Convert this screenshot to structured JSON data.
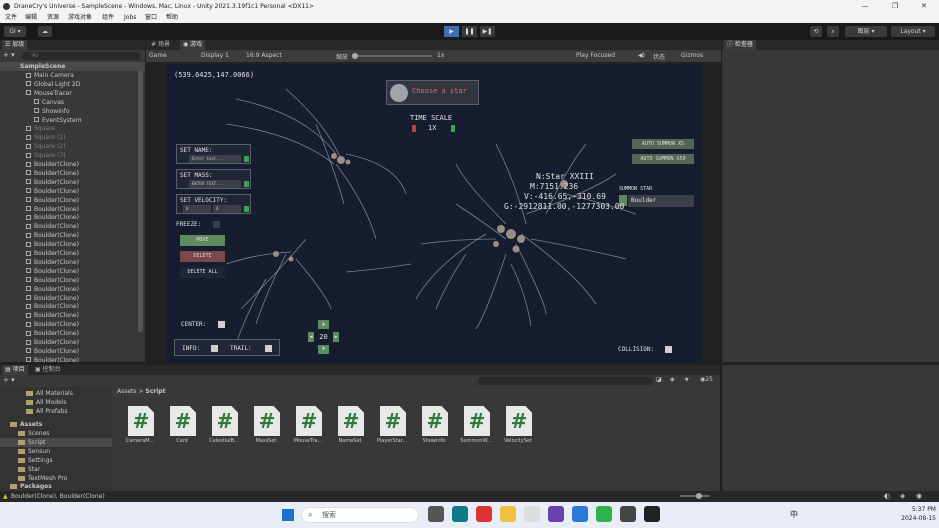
{
  "window": {
    "title": "DraneCry's Universe - SampleScene - Windows, Mac, Linux - Unity 2021.3.19f1c1 Personal <DX11>",
    "minimize": "—",
    "maximize": "❐",
    "close": "✕"
  },
  "menu": [
    "文件",
    "编辑",
    "资源",
    "游戏对象",
    "组件",
    "Jobs",
    "窗口",
    "帮助"
  ],
  "toolbar": {
    "account": "GI ▾",
    "cloud": "☁",
    "play": "▶",
    "pause": "❚❚",
    "step": "▶❚",
    "history": "⟲",
    "search": "⌕",
    "layers": "图层 ▾",
    "layout": "Layout ▾"
  },
  "hierarchy": {
    "tab": "层级",
    "add": "+ ▾",
    "search_placeholder": "All",
    "scene": "SampleScene",
    "items": [
      {
        "label": "Main Camera",
        "dim": false
      },
      {
        "label": "Global Light 2D",
        "dim": false
      },
      {
        "label": "MouseTracer",
        "dim": false
      },
      {
        "label": "Canvas",
        "dim": false
      },
      {
        "label": "ShowInfo",
        "dim": false
      },
      {
        "label": "EventSystem",
        "dim": false
      },
      {
        "label": "Square",
        "dim": true
      },
      {
        "label": "Square (1)",
        "dim": true
      },
      {
        "label": "Square (2)",
        "dim": true
      },
      {
        "label": "Square (3)",
        "dim": true
      },
      {
        "label": "Boulder(Clone)",
        "dim": false
      },
      {
        "label": "Boulder(Clone)",
        "dim": false
      },
      {
        "label": "Boulder(Clone)",
        "dim": false
      },
      {
        "label": "Boulder(Clone)",
        "dim": false
      },
      {
        "label": "Boulder(Clone)",
        "dim": false
      },
      {
        "label": "Boulder(Clone)",
        "dim": false
      },
      {
        "label": "Boulder(Clone)",
        "dim": false
      },
      {
        "label": "Boulder(Clone)",
        "dim": false
      },
      {
        "label": "Boulder(Clone)",
        "dim": false
      },
      {
        "label": "Boulder(Clone)",
        "dim": false
      },
      {
        "label": "Boulder(Clone)",
        "dim": false
      },
      {
        "label": "Boulder(Clone)",
        "dim": false
      },
      {
        "label": "Boulder(Clone)",
        "dim": false
      },
      {
        "label": "Boulder(Clone)",
        "dim": false
      },
      {
        "label": "Boulder(Clone)",
        "dim": false
      },
      {
        "label": "Boulder(Clone)",
        "dim": false
      },
      {
        "label": "Boulder(Clone)",
        "dim": false
      },
      {
        "label": "Boulder(Clone)",
        "dim": false
      },
      {
        "label": "Boulder(Clone)",
        "dim": false
      },
      {
        "label": "Boulder(Clone)",
        "dim": false
      },
      {
        "label": "Boulder(Clone)",
        "dim": false
      },
      {
        "label": "Boulder(Clone)",
        "dim": false
      },
      {
        "label": "Boulder(Clone)",
        "dim": false
      }
    ]
  },
  "center_tabs": {
    "scene": "场景",
    "game": "游戏"
  },
  "game_bar": {
    "mode": "Game",
    "display": "Display 1",
    "aspect": "16:9 Aspect",
    "scale_label": "缩放",
    "scale_value": "1x",
    "play_focused": "Play Focused",
    "stats": "状态",
    "gizmos": "Gizmos"
  },
  "inspector": {
    "tab": "检查器"
  },
  "game": {
    "coords": "(539.6425,147.0066)",
    "choose_star": "Choose a star",
    "time_scale": "TIME SCALE",
    "time_value": "1X",
    "set_name": "SET NAME:",
    "name_placeholder": "Enter text...",
    "set_mass": "SET MASS:",
    "mass_placeholder": "ENTER TEXT...",
    "set_velocity": "SET VELOCITY:",
    "vel_x": "0",
    "vel_y": "0",
    "freeze": "FREEZE:",
    "move": "MOVE",
    "delete": "DELETE",
    "delete_all": "DELETE ALL",
    "center": "CENTER:",
    "info": "INFO:",
    "trail": "TRAIL:",
    "zoom": "20",
    "collision": "COLLISION:",
    "auto_summon_1": "AUTO SUMMON X5",
    "auto_summon_2": "AUTO SUMMON X50",
    "summon_star": "SUMMON STAR",
    "summon_option": "Boulder",
    "star_name": "N:Star XXIII",
    "star_mass": "M:7151.236",
    "star_vel": "V:-416.65,-310.69",
    "star_pos": "G:-2912811.00,-1277303.00"
  },
  "bottom_tabs": {
    "project": "项目",
    "console": "控制台"
  },
  "project": {
    "add": "+ ▾",
    "favorites": [
      "All Materials",
      "All Models",
      "All Prefabs"
    ],
    "assets_root": "Assets",
    "folders": [
      "Scenes",
      "Script",
      "Sensun",
      "Settings",
      "Star",
      "TextMesh Pro"
    ],
    "packages": "Packages",
    "breadcrumb_root": "Assets",
    "breadcrumb_sep": ">",
    "breadcrumb_current": "Script",
    "hidden_count": "25",
    "files": [
      "CameraM...",
      "Card",
      "CelestialB...",
      "MassSet",
      "MouseTra...",
      "NameSet",
      "PlayerStar...",
      "ShowInfo",
      "SummonW...",
      "VelocitySet"
    ]
  },
  "status": {
    "text": "Boulder(Clone), Boulder(Clone)"
  },
  "taskbar": {
    "search": "搜索",
    "lang": "中",
    "time": "5:37 PM",
    "date": "2024-08-15"
  },
  "colors": {
    "accent": "#3d6fb6",
    "panel": "#383838",
    "game_bg": "#161d2e",
    "button_green": "#5f8a5f",
    "button_red": "#7a4848"
  }
}
